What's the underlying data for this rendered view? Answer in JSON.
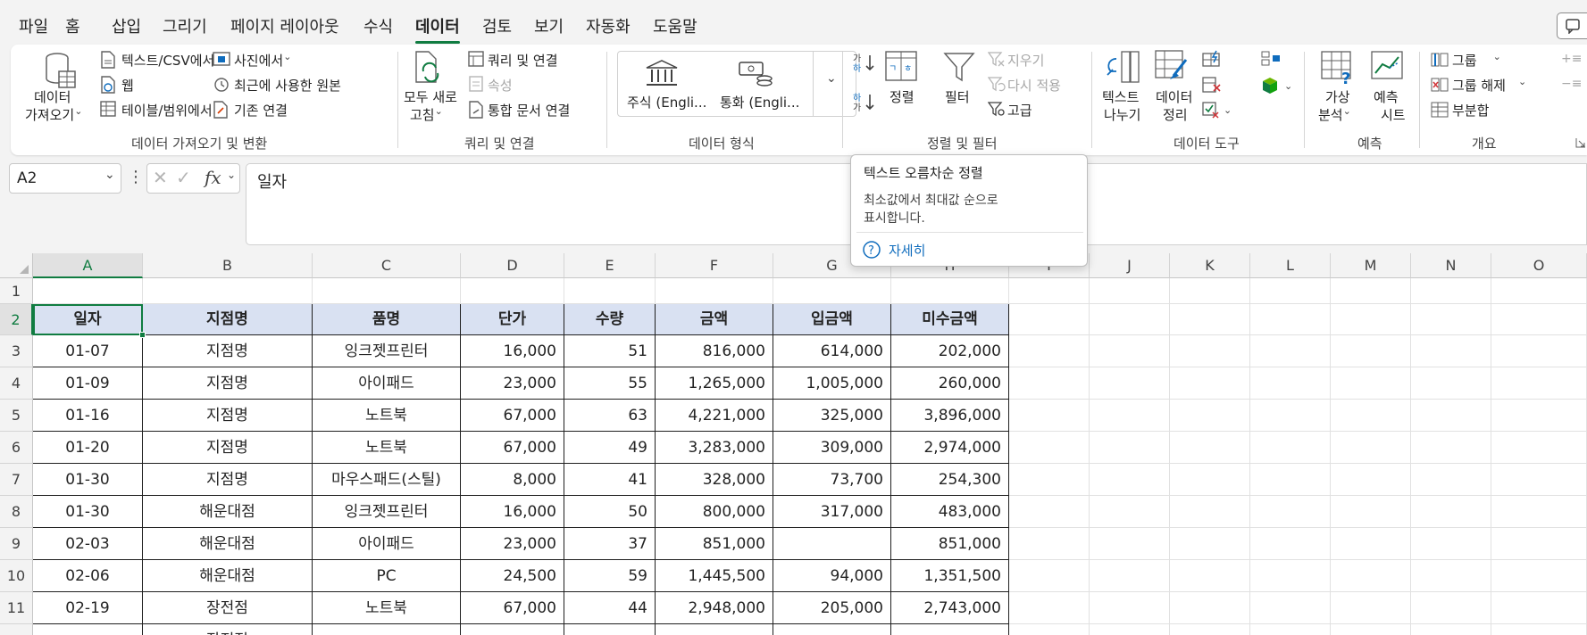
{
  "menu": {
    "tabs": [
      "파일",
      "홈",
      "삽입",
      "그리기",
      "페이지 레이아웃",
      "수식",
      "데이터",
      "검토",
      "보기",
      "자동화",
      "도움말"
    ],
    "active_tab": "데이터"
  },
  "ribbon": {
    "get_transform": {
      "get_data_line1": "데이터",
      "get_data_line2": "가져오기",
      "from_text_csv": "텍스트/CSV에서",
      "from_web": "웹",
      "from_table_range": "테이블/범위에서",
      "from_picture": "사진에서",
      "recent_sources": "최근에 사용한 원본",
      "existing_connections": "기존 연결",
      "group_label": "데이터 가져오기 및 변환"
    },
    "queries": {
      "refresh_all_line1": "모두 새로",
      "refresh_all_line2": "고침",
      "queries_connections": "쿼리 및 연결",
      "properties": "속성",
      "workbook_links": "통합 문서 연결",
      "group_label": "쿼리 및 연결"
    },
    "data_types": {
      "stocks": "주식 (Engli...",
      "currencies": "통화 (Engli...",
      "group_label": "데이터 형식"
    },
    "sort_filter": {
      "sort": "정렬",
      "filter": "필터",
      "clear": "지우기",
      "reapply": "다시 적용",
      "advanced": "고급",
      "group_label": "정렬 및 필터"
    },
    "data_tools": {
      "text_to_columns_line1": "텍스트",
      "text_to_columns_line2": "나누기",
      "data_cleanup_line1": "데이터",
      "data_cleanup_line2": "정리",
      "group_label": "데이터 도구"
    },
    "forecast": {
      "what_if_line1": "가상",
      "what_if_line2": "분석",
      "forecast_sheet_line1": "예측",
      "forecast_sheet_line2": "시트",
      "group_label": "예측"
    },
    "outline": {
      "group": "그룹",
      "ungroup": "그룹 해제",
      "subtotal": "부분합",
      "group_label": "개요"
    }
  },
  "formula_bar": {
    "name_box": "A2",
    "content": "일자"
  },
  "tooltip": {
    "title": "텍스트 오름차순 정렬",
    "line1": "최소값에서 최대값 순으로",
    "line2": "표시합니다.",
    "link": "자세히"
  },
  "sheet": {
    "columns": [
      "A",
      "B",
      "C",
      "D",
      "E",
      "F",
      "G",
      "H",
      "I",
      "J",
      "K",
      "L",
      "M",
      "N",
      "O"
    ],
    "rows": [
      "1",
      "2",
      "3",
      "4",
      "5",
      "6",
      "7",
      "8",
      "9",
      "10",
      "11"
    ],
    "headers": [
      "일자",
      "지점명",
      "품명",
      "단가",
      "수량",
      "금액",
      "입금액",
      "미수금액"
    ],
    "data": [
      [
        "01-07",
        "지점명",
        "잉크젯프린터",
        "16,000",
        "51",
        "816,000",
        "614,000",
        "202,000"
      ],
      [
        "01-09",
        "지점명",
        "아이패드",
        "23,000",
        "55",
        "1,265,000",
        "1,005,000",
        "260,000"
      ],
      [
        "01-16",
        "지점명",
        "노트북",
        "67,000",
        "63",
        "4,221,000",
        "325,000",
        "3,896,000"
      ],
      [
        "01-20",
        "지점명",
        "노트북",
        "67,000",
        "49",
        "3,283,000",
        "309,000",
        "2,974,000"
      ],
      [
        "01-30",
        "지점명",
        "마우스패드(스틸)",
        "8,000",
        "41",
        "328,000",
        "73,700",
        "254,300"
      ],
      [
        "01-30",
        "해운대점",
        "잉크젯프린터",
        "16,000",
        "50",
        "800,000",
        "317,000",
        "483,000"
      ],
      [
        "02-03",
        "해운대점",
        "아이패드",
        "23,000",
        "37",
        "851,000",
        "",
        "851,000"
      ],
      [
        "02-06",
        "해운대점",
        "PC",
        "24,500",
        "59",
        "1,445,500",
        "94,000",
        "1,351,500"
      ],
      [
        "02-19",
        "장전점",
        "노트북",
        "67,000",
        "44",
        "2,948,000",
        "205,000",
        "2,743,000"
      ]
    ],
    "partial_row_b": "장전점"
  },
  "colors": {
    "accent": "#107c41",
    "header_fill": "#d9e1f2",
    "tooltip_link": "#0f6cbd"
  }
}
